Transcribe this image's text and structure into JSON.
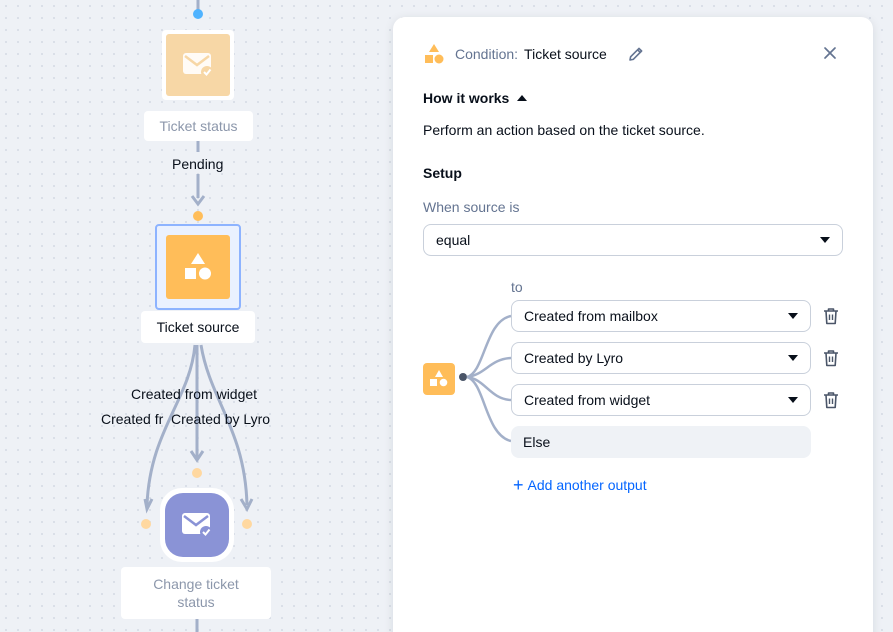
{
  "flow": {
    "node_ticket_status": {
      "label": "Ticket status"
    },
    "edge_pending": {
      "label": "Pending"
    },
    "node_ticket_source": {
      "label": "Ticket source"
    },
    "edge_widget": {
      "label": "Created from widget"
    },
    "edge_overlap_left": {
      "label": "Created fr"
    },
    "edge_lyro": {
      "label": "Created by Lyro"
    },
    "node_change_status": {
      "label": "Change ticket status"
    }
  },
  "panel": {
    "title_prefix": "Condition:",
    "title": "Ticket source",
    "how_it_works": "How it works",
    "description": "Perform an action based on the ticket source.",
    "setup_heading": "Setup",
    "when_label": "When source is",
    "operator_value": "equal",
    "to_label": "to",
    "outputs": [
      {
        "value": "Created from mailbox"
      },
      {
        "value": "Created by Lyro"
      },
      {
        "value": "Created from widget"
      }
    ],
    "else_label": "Else",
    "add_output": "Add another output"
  },
  "colors": {
    "accent_blue": "#0566ff",
    "condition_orange": "#ffbd59",
    "status_light_orange": "#f7d7a6",
    "action_purple": "#8a93d6",
    "connector": "#a3b0c9"
  }
}
